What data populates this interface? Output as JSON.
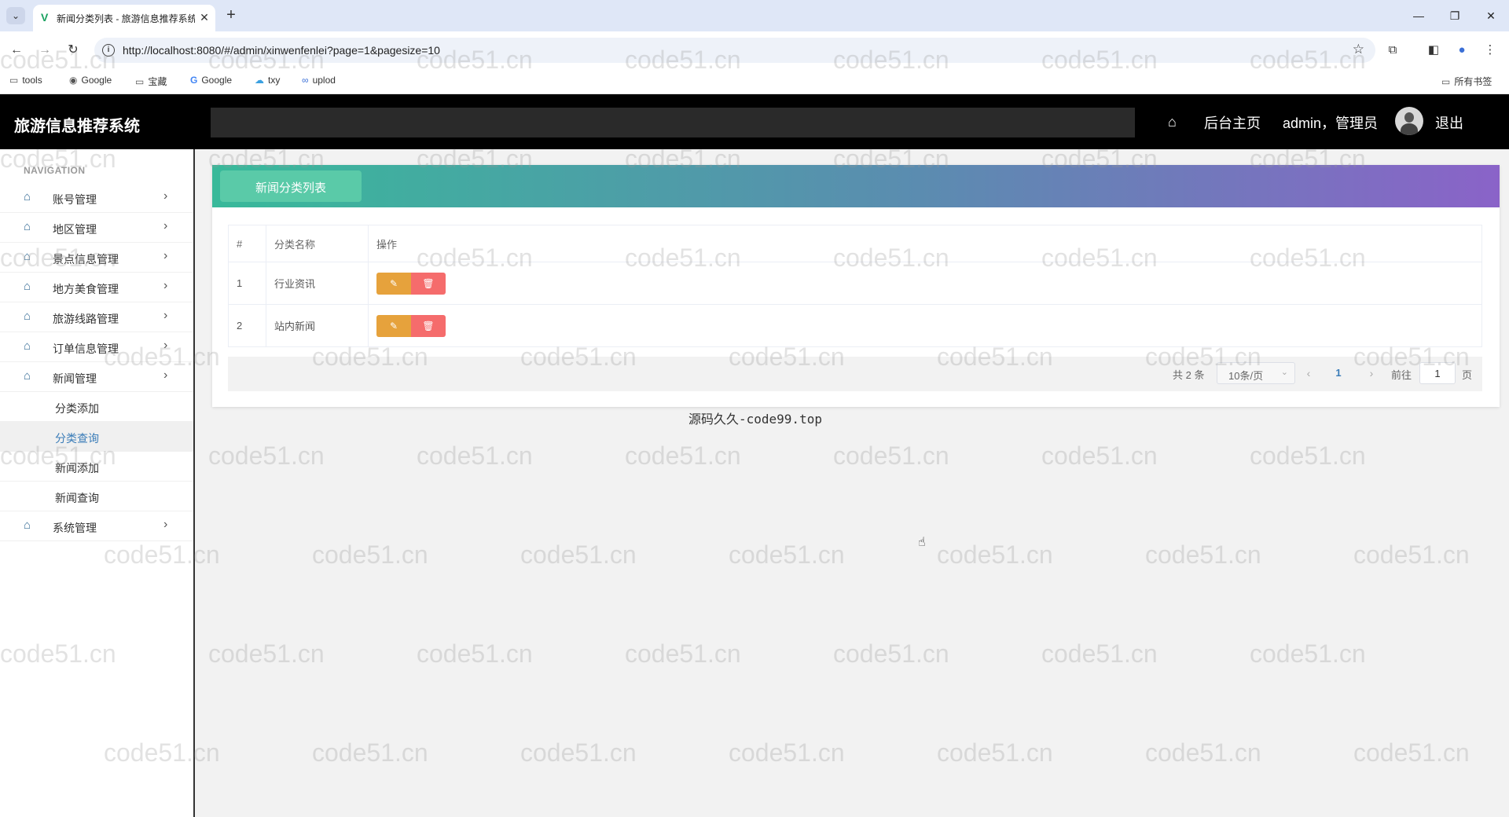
{
  "browser": {
    "tab_title": "新闻分类列表 - 旅游信息推荐系统",
    "url": "http://localhost:8080/#/admin/xinwenfenlei?page=1&pagesize=10",
    "bookmarks": [
      {
        "label": "tools",
        "icon": "folder-icon"
      },
      {
        "label": "Google",
        "icon": "globe-icon"
      },
      {
        "label": "宝藏",
        "icon": "folder-icon"
      },
      {
        "label": "Google",
        "icon": "google-icon"
      },
      {
        "label": "txy",
        "icon": "cloud-icon"
      },
      {
        "label": "uplod",
        "icon": "link-icon"
      }
    ],
    "all_bookmarks": "所有书签"
  },
  "header": {
    "app_title": "旅游信息推荐系统",
    "home_label": "后台主页",
    "user_label": "admin，管理员",
    "logout_label": "退出"
  },
  "sidebar": {
    "caption": "NAVIGATION",
    "menu": [
      {
        "label": "账号管理",
        "icon": "home-icon"
      },
      {
        "label": "地区管理",
        "icon": "home-icon"
      },
      {
        "label": "景点信息管理",
        "icon": "home-icon"
      },
      {
        "label": "地方美食管理",
        "icon": "home-icon"
      },
      {
        "label": "旅游线路管理",
        "icon": "home-icon"
      },
      {
        "label": "订单信息管理",
        "icon": "home-icon"
      },
      {
        "label": "新闻管理",
        "icon": "home-icon"
      }
    ],
    "submenu": [
      {
        "label": "分类添加"
      },
      {
        "label": "分类查询",
        "active": true
      },
      {
        "label": "新闻添加"
      },
      {
        "label": "新闻查询"
      }
    ],
    "last_menu": {
      "label": "系统管理",
      "icon": "home-icon"
    }
  },
  "main": {
    "banner_tab": "新闻分类列表",
    "table": {
      "headers": [
        "#",
        "分类名称",
        "操作"
      ],
      "rows": [
        {
          "index": "1",
          "name": "行业资讯"
        },
        {
          "index": "2",
          "name": "站内新闻"
        }
      ]
    },
    "pagination": {
      "total": "共 2 条",
      "page_size": "10条/页",
      "current_page": "1",
      "goto_label": "前往",
      "goto_value": "1",
      "page_suffix": "页"
    },
    "footer": "源码久久-code99.top"
  },
  "watermark": "code51.cn",
  "colors": {
    "header_bg": "#000000",
    "banner_start": "#38b99a",
    "banner_end": "#8a63c8",
    "edit_button": "#e6a23c",
    "delete_button": "#f56c6c",
    "active_link": "#3a7cb8"
  }
}
